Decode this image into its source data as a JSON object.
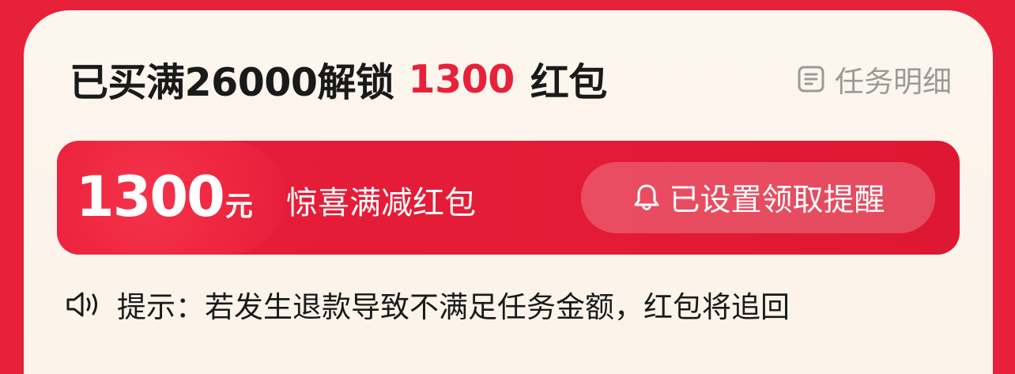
{
  "header": {
    "title_prefix": "已买满26000解锁",
    "title_amount": "1300",
    "title_suffix": "红包",
    "detail_label": "任务明细",
    "detail_icon": "list-icon"
  },
  "coupon": {
    "value": "1300",
    "unit": "元",
    "name": "惊喜满减红包",
    "reminder_label": "已设置领取提醒",
    "reminder_icon": "bell-icon"
  },
  "tip": {
    "icon": "speaker-icon",
    "text": "提示：若发生退款导致不满足任务金额，红包将追回"
  },
  "colors": {
    "background": "#e8213a",
    "accent": "#e8213a",
    "card": "#fdf6ee"
  }
}
